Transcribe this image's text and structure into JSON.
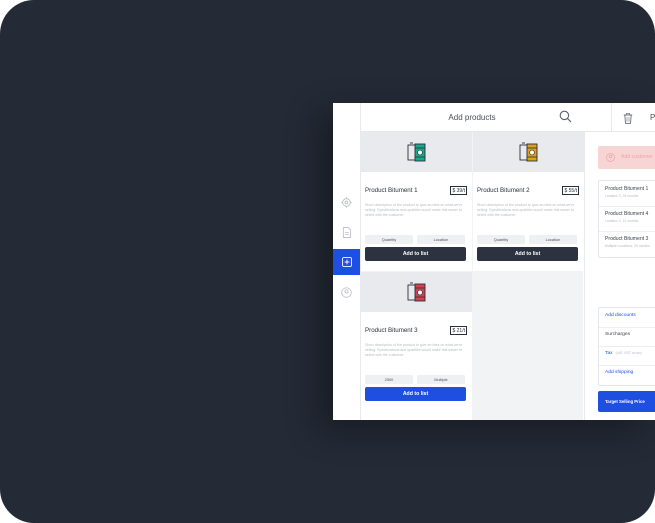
{
  "header": {
    "title": "Add products",
    "panel_title": "P"
  },
  "products": [
    {
      "name": "Product Bitument 1",
      "price": "$ 39/t",
      "description": "Short description of the product to give an idea on what we're selling. Specifications and qualities would make this easier to select with the customer.",
      "pill_left": "Quantity",
      "pill_right": "Location",
      "button": "Add to list",
      "icon_color": "#1aa88a"
    },
    {
      "name": "Product Bitument 2",
      "price": "$ 55/t",
      "description": "Short description of the product to give an idea on what we're selling. Specifications and qualities would make this easier to select with the customer.",
      "pill_left": "Quantity",
      "pill_right": "Location",
      "button": "Add to list",
      "icon_color": "#d9a21b"
    },
    {
      "name": "Product Bitument 3",
      "price": "$ 21/t",
      "description": "Short description of the product to give an idea on what we're selling. Specifications and qualities would make this easier to select with the customer.",
      "pill_left": "2500",
      "pill_right": "Multiple",
      "button": "Add to list",
      "icon_color": "#d6404a"
    }
  ],
  "panel": {
    "add_customer": "Add customer",
    "list": [
      {
        "name": "Product Bitument 1",
        "sub": "Location 3, 25 months"
      },
      {
        "name": "Product Bitument 4",
        "sub": "Location 3, 12 months"
      },
      {
        "name": "Product Bitument 3",
        "sub": "Multiple Locations, 25 months"
      }
    ],
    "add_discounts": "Add discounts",
    "surcharges": "Surcharges",
    "tax": "Tax",
    "tax_note": "(VAT, GST no tax)",
    "add_shipping": "Add shipping",
    "target_button": "Target Selling Price"
  },
  "sidebar": {
    "icons": [
      "settings-icon",
      "document-icon",
      "add-square-icon",
      "account-icon"
    ],
    "active": "add-square-icon"
  },
  "colors": {
    "accent": "#1f4fe0",
    "dark_button": "#2c3240",
    "frame_bg": "#242a36"
  }
}
